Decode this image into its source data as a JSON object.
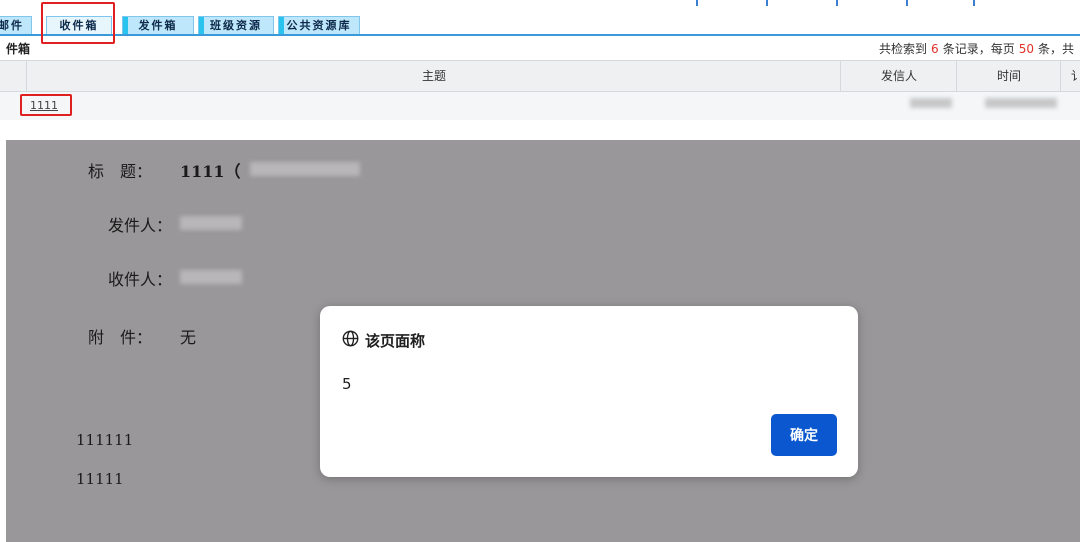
{
  "tabs": [
    {
      "label": "邮件",
      "active": false
    },
    {
      "label": "收件箱",
      "active": true
    },
    {
      "label": "发件箱",
      "active": false
    },
    {
      "label": "班级资源",
      "active": false
    },
    {
      "label": "公共资源库",
      "active": false
    }
  ],
  "folder": {
    "title": "件箱",
    "summary_prefix": "共检索到",
    "total": "6",
    "summary_mid": "条记录，每页",
    "per_page": "50",
    "summary_suffix": "条，共"
  },
  "table": {
    "columns": [
      "主题",
      "发信人",
      "时间",
      "讠"
    ],
    "rows": [
      {
        "subject": "1111"
      }
    ]
  },
  "letter": {
    "title_label": "标　题：",
    "title_value": "1111（",
    "from_label": "发件人：",
    "to_label": "收件人：",
    "attach_label": "附　件：",
    "attach_value": "无",
    "body_lines": [
      "111111",
      "11111"
    ]
  },
  "dialog": {
    "icon": "globe-icon",
    "title": "该页面称",
    "message": "5",
    "ok_label": "确定"
  },
  "colors": {
    "accent_red": "#e02020",
    "dialog_button": "#0b57d0",
    "tab_bg": "#bfe7fb",
    "overlay": "#999799"
  }
}
